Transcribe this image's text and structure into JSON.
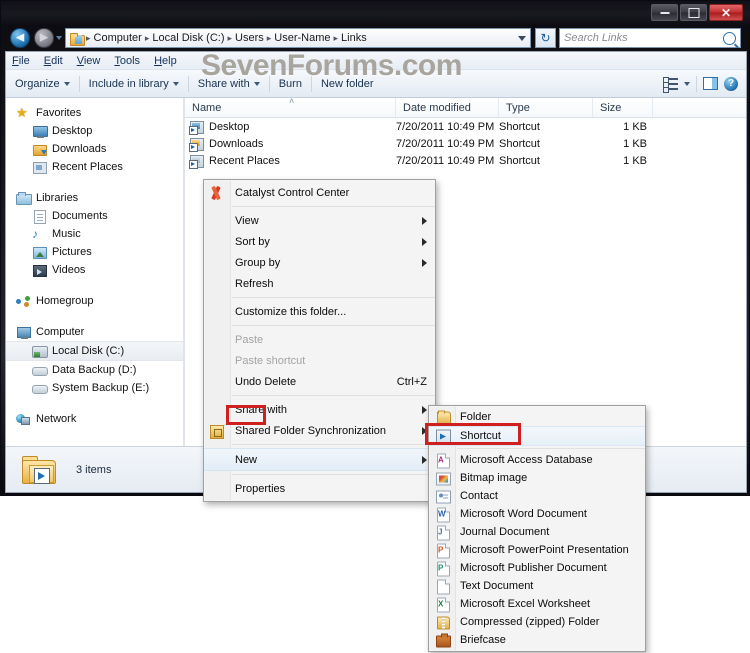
{
  "window": {
    "controls": {
      "minimize": "–",
      "maximize": "□",
      "close": "✕"
    }
  },
  "address_bar": {
    "back_arrow": "◀",
    "forward_arrow": "▶",
    "crumbs": [
      "Computer",
      "Local Disk (C:)",
      "Users",
      "User-Name",
      "Links"
    ],
    "separator": "▸",
    "refresh_glyph": "↻"
  },
  "search": {
    "placeholder": "Search Links"
  },
  "menubar": {
    "items": [
      "File",
      "Edit",
      "View",
      "Tools",
      "Help"
    ]
  },
  "toolbar": {
    "organize": "Organize",
    "include_in_library": "Include in library",
    "share_with": "Share with",
    "burn": "Burn",
    "new_folder": "New folder",
    "help_glyph": "?"
  },
  "watermark": {
    "text": "SevenForums.com",
    "color": "#a8a49e"
  },
  "navpane": {
    "groups": [
      {
        "header": {
          "label": "Favorites",
          "icon": "star-icon"
        },
        "children": [
          {
            "label": "Desktop",
            "icon": "desktop-icon"
          },
          {
            "label": "Downloads",
            "icon": "downloads-icon"
          },
          {
            "label": "Recent Places",
            "icon": "recent-places-icon"
          }
        ]
      },
      {
        "header": {
          "label": "Libraries",
          "icon": "libraries-icon"
        },
        "children": [
          {
            "label": "Documents",
            "icon": "documents-icon"
          },
          {
            "label": "Music",
            "icon": "music-icon"
          },
          {
            "label": "Pictures",
            "icon": "pictures-icon"
          },
          {
            "label": "Videos",
            "icon": "videos-icon"
          }
        ]
      },
      {
        "header": {
          "label": "Homegroup",
          "icon": "homegroup-icon"
        },
        "children": []
      },
      {
        "header": {
          "label": "Computer",
          "icon": "computer-icon"
        },
        "children": [
          {
            "label": "Local Disk (C:)",
            "icon": "hard-disk-icon",
            "selected": true
          },
          {
            "label": "Data Backup (D:)",
            "icon": "drive-icon"
          },
          {
            "label": "System Backup (E:)",
            "icon": "drive-icon"
          }
        ]
      },
      {
        "header": {
          "label": "Network",
          "icon": "network-icon"
        },
        "children": []
      }
    ]
  },
  "filelist": {
    "columns": [
      "Name",
      "Date modified",
      "Type",
      "Size"
    ],
    "sort_indicator": "˄",
    "rows": [
      {
        "name": "Desktop",
        "date": "7/20/2011 10:49 PM",
        "type": "Shortcut",
        "size": "1 KB",
        "icon": "shortcut-desktop-icon"
      },
      {
        "name": "Downloads",
        "date": "7/20/2011 10:49 PM",
        "type": "Shortcut",
        "size": "1 KB",
        "icon": "shortcut-downloads-icon"
      },
      {
        "name": "Recent Places",
        "date": "7/20/2011 10:49 PM",
        "type": "Shortcut",
        "size": "1 KB",
        "icon": "shortcut-recent-places-icon"
      }
    ]
  },
  "statusbar": {
    "item_count": "3 items"
  },
  "context_menu": {
    "items": [
      {
        "label": "Catalyst Control Center",
        "icon": "catalyst-icon"
      },
      {
        "label": "View",
        "submenu": true
      },
      {
        "label": "Sort by",
        "submenu": true
      },
      {
        "label": "Group by",
        "submenu": true
      },
      {
        "label": "Refresh"
      },
      {
        "label": "Customize this folder..."
      },
      {
        "label": "Paste",
        "disabled": true
      },
      {
        "label": "Paste shortcut",
        "disabled": true
      },
      {
        "label": "Undo Delete",
        "accel": "Ctrl+Z"
      },
      {
        "label": "Share with",
        "submenu": true
      },
      {
        "label": "Shared Folder Synchronization",
        "submenu": true,
        "icon": "sync-icon"
      },
      {
        "label": "New",
        "submenu": true,
        "highlighted": true
      },
      {
        "label": "Properties"
      }
    ]
  },
  "new_submenu": {
    "items": [
      {
        "label": "Folder",
        "icon": "folder-icon"
      },
      {
        "label": "Shortcut",
        "icon": "shortcut-icon",
        "highlighted": true
      },
      {
        "label": "Microsoft Access Database",
        "icon": "access-icon",
        "glyph": "A"
      },
      {
        "label": "Bitmap image",
        "icon": "bitmap-icon"
      },
      {
        "label": "Contact",
        "icon": "contact-icon"
      },
      {
        "label": "Microsoft Word Document",
        "icon": "word-icon",
        "glyph": "W"
      },
      {
        "label": "Journal Document",
        "icon": "journal-icon",
        "glyph": "J"
      },
      {
        "label": "Microsoft PowerPoint Presentation",
        "icon": "powerpoint-icon",
        "glyph": "P"
      },
      {
        "label": "Microsoft Publisher Document",
        "icon": "publisher-icon",
        "glyph": "P"
      },
      {
        "label": "Text Document",
        "icon": "text-document-icon"
      },
      {
        "label": "Microsoft Excel Worksheet",
        "icon": "excel-icon",
        "glyph": "X"
      },
      {
        "label": "Compressed (zipped) Folder",
        "icon": "zip-folder-icon"
      },
      {
        "label": "Briefcase",
        "icon": "briefcase-icon"
      }
    ]
  },
  "annotations": {
    "highlight_color": "#cf1f1f",
    "boxes": [
      "new-menu-item",
      "shortcut-submenu-item"
    ]
  }
}
